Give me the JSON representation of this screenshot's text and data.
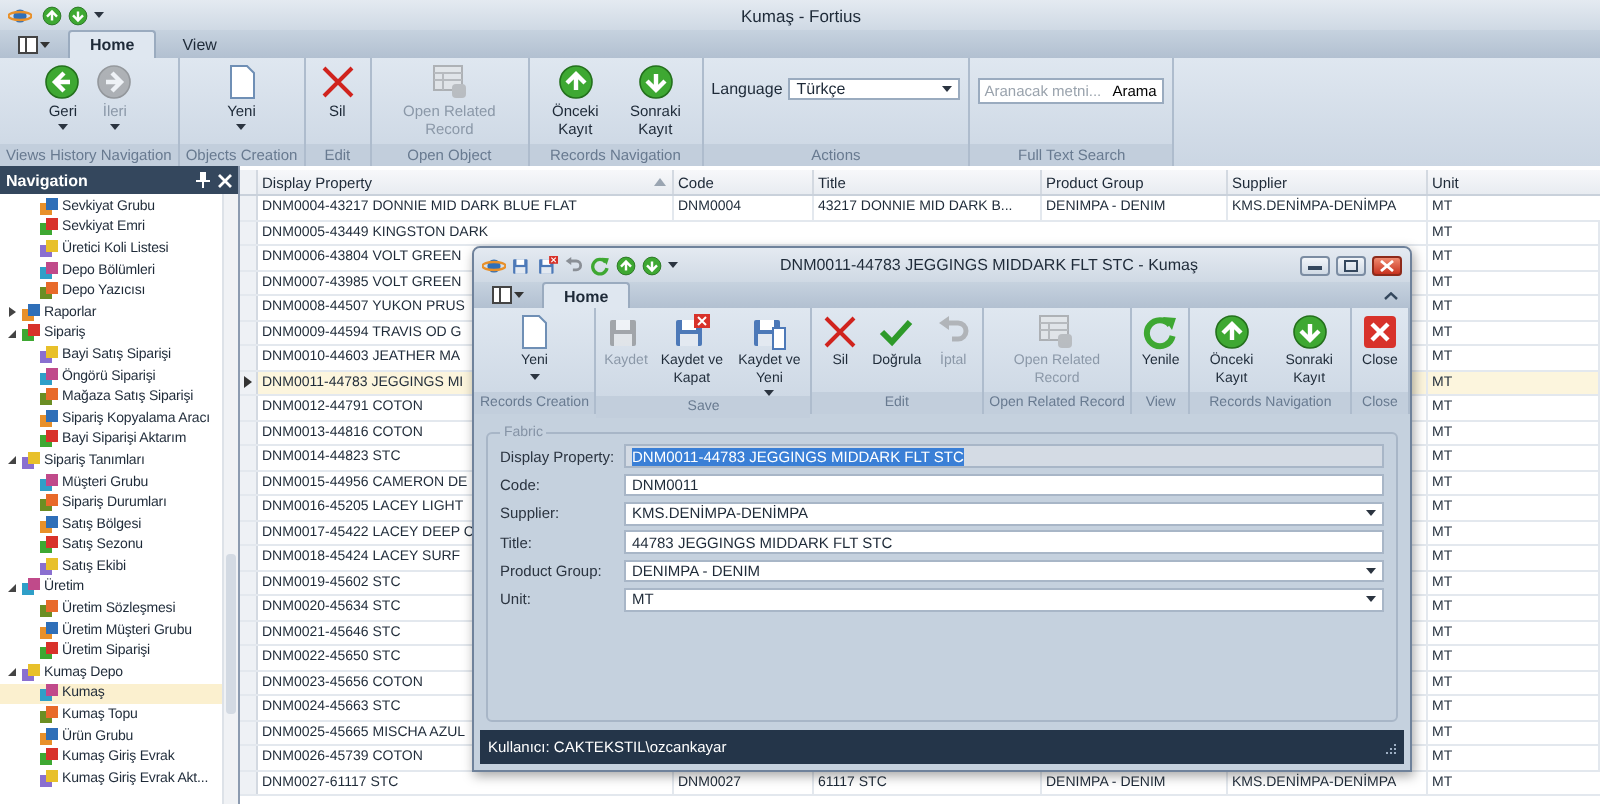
{
  "window": {
    "title": "Kumaş - Fortius"
  },
  "ribbon": {
    "tabs": [
      {
        "label": "Home",
        "selected": true
      },
      {
        "label": "View",
        "selected": false
      }
    ],
    "groups": [
      {
        "label": "Views History Navigation",
        "kind": "buttons",
        "buttons": [
          {
            "kind": "back",
            "label": "Geri",
            "disabled": false,
            "dropdown": true
          },
          {
            "kind": "forward",
            "label": "İleri",
            "disabled": true,
            "dropdown": true
          }
        ]
      },
      {
        "label": "Objects Creation",
        "kind": "buttons",
        "buttons": [
          {
            "kind": "new",
            "label": "Yeni",
            "disabled": false,
            "dropdown": true
          }
        ]
      },
      {
        "label": "Edit",
        "kind": "buttons",
        "buttons": [
          {
            "kind": "delete",
            "label": "Sil",
            "disabled": false,
            "dropdown": false
          }
        ]
      },
      {
        "label": "Open Object",
        "kind": "buttons",
        "buttons": [
          {
            "kind": "related",
            "label": "Open Related Record",
            "disabled": true,
            "dropdown": false
          }
        ]
      },
      {
        "label": "Records Navigation",
        "kind": "buttons",
        "buttons": [
          {
            "kind": "previous",
            "label": "Önceki Kayıt",
            "disabled": false,
            "dropdown": false
          },
          {
            "kind": "next",
            "label": "Sonraki Kayıt",
            "disabled": false,
            "dropdown": false
          }
        ]
      },
      {
        "label": "Actions",
        "kind": "language",
        "language_label": "Language",
        "language_value": "Türkçe"
      },
      {
        "label": "Full Text Search",
        "kind": "search",
        "placeholder": "Aranacak metni...",
        "button": "Arama"
      }
    ]
  },
  "navigation": {
    "title": "Navigation",
    "continued_items": [
      {
        "label": "Sevkiyat Grubu",
        "selected": false
      },
      {
        "label": "Sevkiyat Emri",
        "selected": false
      },
      {
        "label": "Üretici Koli Listesi",
        "selected": false
      },
      {
        "label": "Depo Bölümleri",
        "selected": false
      },
      {
        "label": "Depo Yazıcısı",
        "selected": false
      }
    ],
    "items": [
      {
        "label": "Raporlar",
        "selected": false,
        "expanded": false
      },
      {
        "label": "Sipariş",
        "selected": false,
        "expanded": true,
        "children": [
          {
            "label": "Bayi Satış Siparişi",
            "selected": false
          },
          {
            "label": "Öngörü Siparişi",
            "selected": false
          },
          {
            "label": "Mağaza Satış Siparişi",
            "selected": false
          },
          {
            "label": "Sipariş Kopyalama Aracı",
            "selected": false
          },
          {
            "label": "Bayi Siparişi Aktarım",
            "selected": false
          }
        ]
      },
      {
        "label": "Sipariş Tanımları",
        "selected": false,
        "expanded": true,
        "children": [
          {
            "label": "Müşteri Grubu",
            "selected": false
          },
          {
            "label": "Sipariş Durumları",
            "selected": false
          },
          {
            "label": "Satış Bölgesi",
            "selected": false
          },
          {
            "label": "Satış Sezonu",
            "selected": false
          },
          {
            "label": "Satış Ekibi",
            "selected": false
          }
        ]
      },
      {
        "label": "Üretim",
        "selected": false,
        "expanded": true,
        "children": [
          {
            "label": "Üretim Sözleşmesi",
            "selected": false
          },
          {
            "label": "Üretim Müşteri Grubu",
            "selected": false
          },
          {
            "label": "Üretim Siparişi",
            "selected": false
          }
        ]
      },
      {
        "label": "Kumaş Depo",
        "selected": false,
        "expanded": true,
        "children": [
          {
            "label": "Kumaş",
            "selected": true
          },
          {
            "label": "Kumaş Topu",
            "selected": false
          },
          {
            "label": "Ürün Grubu",
            "selected": false
          },
          {
            "label": "Kumaş Giriş Evrak",
            "selected": false
          },
          {
            "label": "Kumaş Giriş Evrak Akt...",
            "selected": false
          }
        ]
      }
    ]
  },
  "grid": {
    "columns": [
      {
        "label": "Display Property",
        "sorted": true
      },
      {
        "label": "Code",
        "sorted": false
      },
      {
        "label": "Title",
        "sorted": false
      },
      {
        "label": "Product Group",
        "sorted": false
      },
      {
        "label": "Supplier",
        "sorted": false
      },
      {
        "label": "Unit",
        "sorted": false
      }
    ],
    "rows": [
      {
        "display": "DNM0004-43217 DONNIE MID DARK BLUE FLAT",
        "code": "DNM0004",
        "title": "43217 DONNIE MID DARK B...",
        "product_group": "DENIMPA - DENIM",
        "supplier": "KMS.DENİMPA-DENİMPA",
        "unit": "MT",
        "selected": false
      },
      {
        "display": "DNM0005-43449 KINGSTON DARK",
        "unit": "MT",
        "selected": false
      },
      {
        "display": "DNM0006-43804 VOLT GREEN",
        "unit": "MT",
        "selected": false
      },
      {
        "display": "DNM0007-43985 VOLT GREEN",
        "unit": "MT",
        "selected": false
      },
      {
        "display": "DNM0008-44507 YUKON PRUS",
        "unit": "MT",
        "selected": false
      },
      {
        "display": "DNM0009-44594 TRAVIS OD G",
        "unit": "MT",
        "selected": false
      },
      {
        "display": "DNM0010-44603 JEATHER MA",
        "unit": "MT",
        "selected": false
      },
      {
        "display": "DNM0011-44783 JEGGINGS MI",
        "unit": "MT",
        "selected": true
      },
      {
        "display": "DNM0012-44791 COTON",
        "unit": "MT",
        "selected": false
      },
      {
        "display": "DNM0013-44816 COTON",
        "unit": "MT",
        "selected": false
      },
      {
        "display": "DNM0014-44823 STC",
        "unit": "MT",
        "selected": false
      },
      {
        "display": "DNM0015-44956 CAMERON DE",
        "unit": "MT",
        "selected": false
      },
      {
        "display": "DNM0016-45205 LACEY LIGHT",
        "unit": "MT",
        "selected": false
      },
      {
        "display": "DNM0017-45422 LACEY DEEP C",
        "unit": "MT",
        "selected": false
      },
      {
        "display": "DNM0018-45424 LACEY SURF",
        "unit": "MT",
        "selected": false
      },
      {
        "display": "DNM0019-45602 STC",
        "unit": "MT",
        "selected": false
      },
      {
        "display": "DNM0020-45634 STC",
        "unit": "MT",
        "selected": false
      },
      {
        "display": "DNM0021-45646 STC",
        "unit": "MT",
        "selected": false
      },
      {
        "display": "DNM0022-45650 STC",
        "unit": "MT",
        "selected": false
      },
      {
        "display": "DNM0023-45656 COTON",
        "unit": "MT",
        "selected": false
      },
      {
        "display": "DNM0024-45663 STC",
        "unit": "MT",
        "selected": false
      },
      {
        "display": "DNM0025-45665 MISCHA AZUL",
        "unit": "MT",
        "selected": false
      },
      {
        "display": "DNM0026-45739 COTON",
        "unit": "MT",
        "selected": false
      },
      {
        "display": "DNM0027-61117 STC",
        "code": "DNM0027",
        "title": "61117 STC",
        "product_group": "DENIMPA - DENIM",
        "supplier": "KMS.DENİMPA-DENİMPA",
        "unit": "MT",
        "selected": false
      }
    ]
  },
  "dialog": {
    "title": "DNM0011-44783 JEGGINGS MIDDARK FLT STC - Kumaş",
    "tabs": [
      {
        "label": "Home",
        "selected": true
      }
    ],
    "groups": [
      {
        "label": "Records Creation",
        "kind": "buttons",
        "buttons": [
          {
            "kind": "new",
            "label": "Yeni",
            "disabled": false,
            "dropdown": true
          }
        ]
      },
      {
        "label": "Save",
        "kind": "buttons",
        "buttons": [
          {
            "kind": "save",
            "label": "Kaydet",
            "disabled": true,
            "dropdown": false
          },
          {
            "kind": "saveclose",
            "label": "Kaydet ve Kapat",
            "disabled": false,
            "dropdown": false
          },
          {
            "kind": "savenew",
            "label": "Kaydet ve Yeni",
            "disabled": false,
            "dropdown": true
          }
        ]
      },
      {
        "label": "Edit",
        "kind": "buttons",
        "buttons": [
          {
            "kind": "delete",
            "label": "Sil",
            "disabled": false,
            "dropdown": false
          },
          {
            "kind": "validate",
            "label": "Doğrula",
            "disabled": false,
            "dropdown": false
          },
          {
            "kind": "undo",
            "label": "İptal",
            "disabled": true,
            "dropdown": false
          }
        ]
      },
      {
        "label": "Open Related Record",
        "kind": "buttons",
        "buttons": [
          {
            "kind": "related",
            "label": "Open Related Record",
            "disabled": true,
            "dropdown": false
          }
        ]
      },
      {
        "label": "View",
        "kind": "buttons",
        "buttons": [
          {
            "kind": "refresh",
            "label": "Yenile",
            "disabled": false,
            "dropdown": false
          }
        ]
      },
      {
        "label": "Records Navigation",
        "kind": "buttons",
        "buttons": [
          {
            "kind": "previous",
            "label": "Önceki Kayıt",
            "disabled": false,
            "dropdown": false
          },
          {
            "kind": "next",
            "label": "Sonraki Kayıt",
            "disabled": false,
            "dropdown": false
          }
        ]
      },
      {
        "label": "Close",
        "kind": "buttons",
        "buttons": [
          {
            "kind": "close",
            "label": "Close",
            "disabled": false,
            "dropdown": false
          }
        ]
      }
    ],
    "form": {
      "legend": "Fabric",
      "fields": [
        {
          "label": "Display Property:",
          "value": "DNM0011-44783 JEGGINGS MIDDARK FLT STC",
          "kind": "text",
          "disabled": true,
          "text_selected": true
        },
        {
          "label": "Code:",
          "value": "DNM0011",
          "kind": "text",
          "disabled": false,
          "text_selected": false
        },
        {
          "label": "Supplier:",
          "value": "KMS.DENİMPA-DENİMPA",
          "kind": "combo",
          "disabled": false,
          "text_selected": false
        },
        {
          "label": "Title:",
          "value": "44783 JEGGINGS MIDDARK FLT STC",
          "kind": "text",
          "disabled": false,
          "text_selected": false
        },
        {
          "label": "Product Group:",
          "value": "DENIMPA - DENIM",
          "kind": "combo",
          "disabled": false,
          "text_selected": false
        },
        {
          "label": "Unit:",
          "value": "MT",
          "kind": "combo",
          "disabled": false,
          "text_selected": false
        }
      ]
    },
    "status": "Kullanıcı: CAKTEKSTIL\\ozcankayar"
  }
}
